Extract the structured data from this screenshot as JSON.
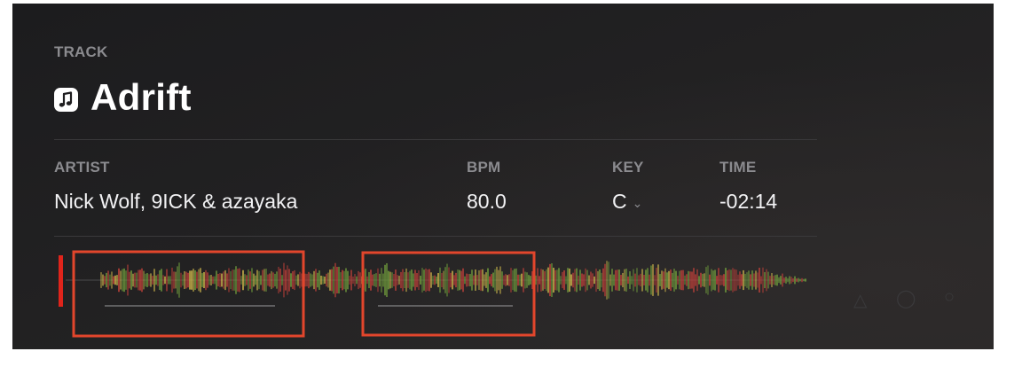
{
  "track": {
    "label": "TRACK",
    "title": "Adrift"
  },
  "artist": {
    "label": "ARTIST",
    "value": "Nick Wolf, 9ICK & azayaka"
  },
  "bpm": {
    "label": "BPM",
    "value": "80.0"
  },
  "key": {
    "label": "KEY",
    "value": "C"
  },
  "time": {
    "label": "TIME",
    "value": "-02:14"
  },
  "colors": {
    "background": "#1e1d1f",
    "playhead": "#e0241b",
    "highlight_box": "#e2462c",
    "wave_red": "#c0413a",
    "wave_green": "#6f9a3c",
    "wave_yellow": "#c9b24a"
  },
  "icons": {
    "track": "music-note-icon",
    "key_dropdown": "chevron-down-icon"
  }
}
